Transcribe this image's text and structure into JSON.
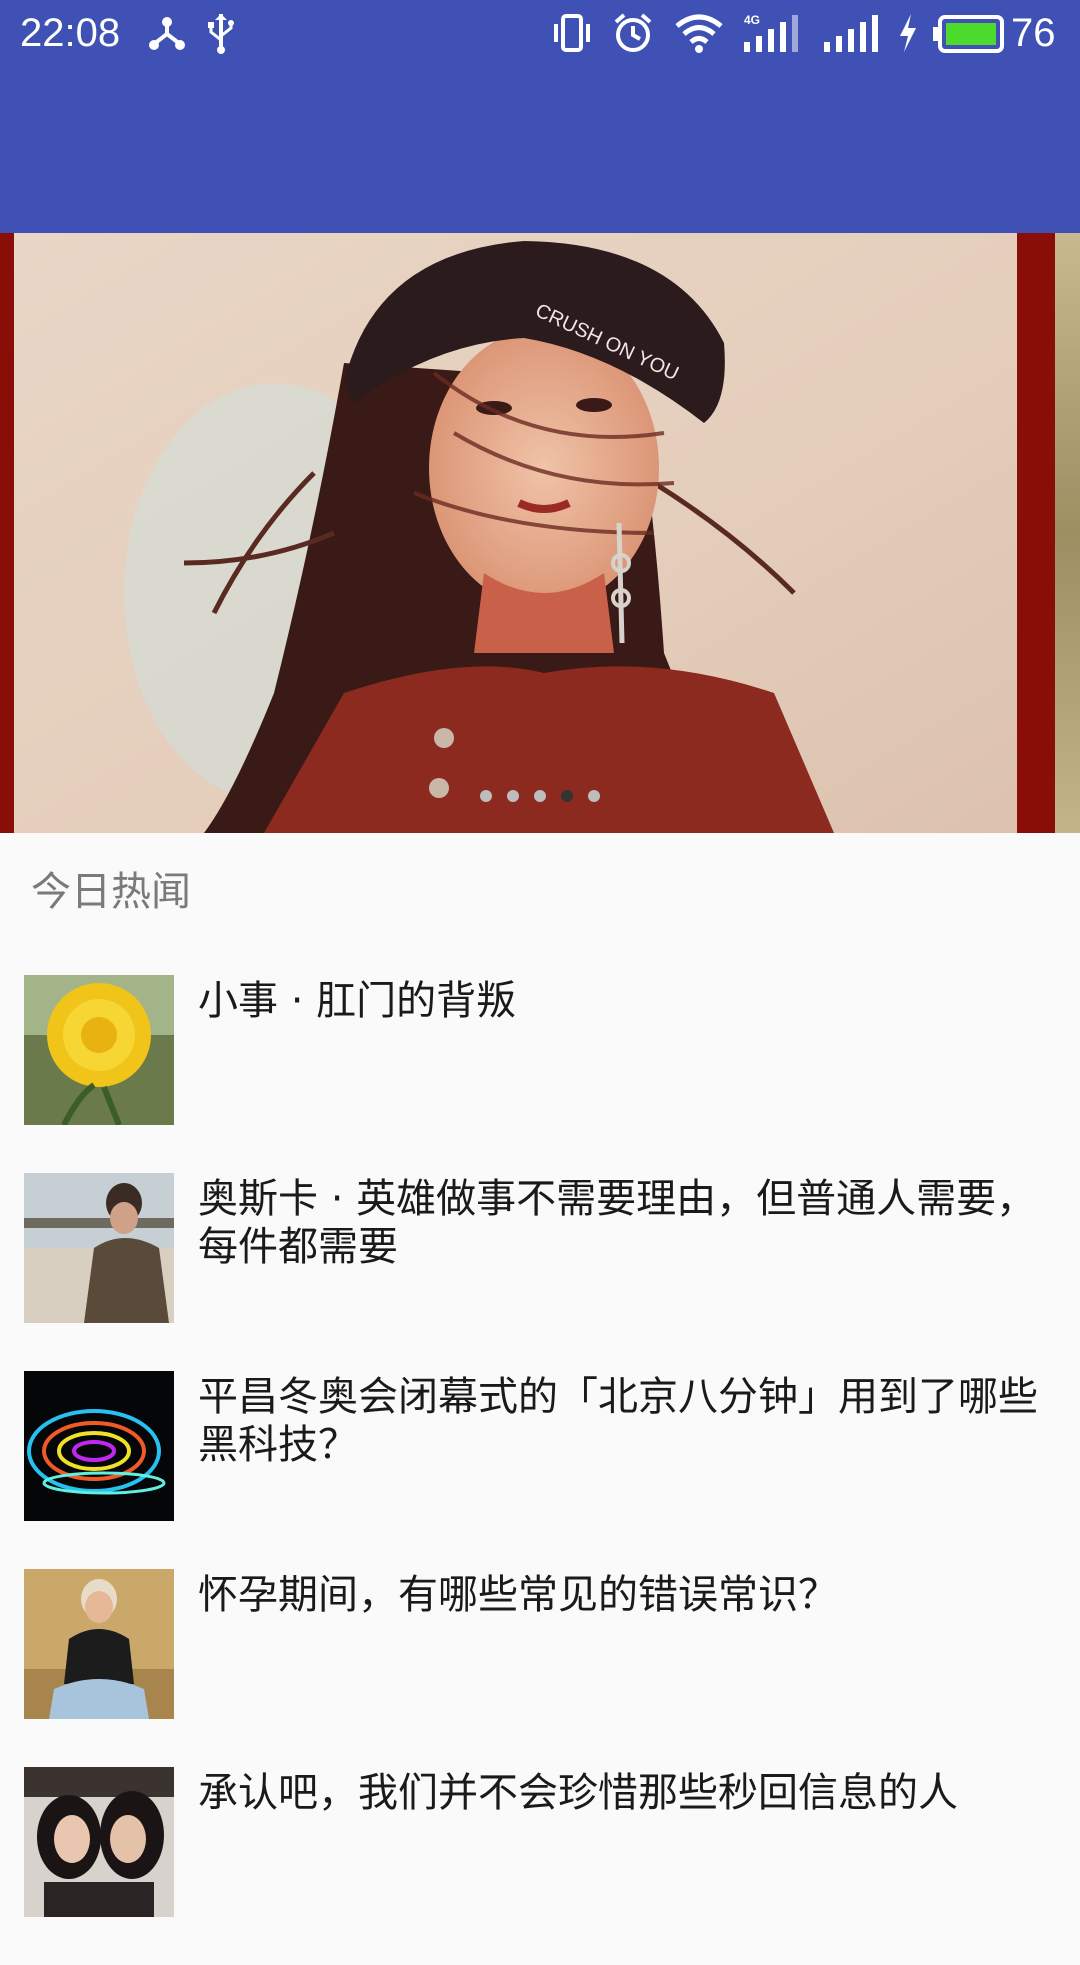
{
  "status_bar": {
    "time": "22:08",
    "battery": "76",
    "icons": [
      "network-share-icon",
      "usb-icon",
      "vibrate-icon",
      "alarm-icon",
      "wifi-icon",
      "4g-signal-icon",
      "signal-icon",
      "charging-icon",
      "battery-icon"
    ],
    "battery_color": "#4cdb2c"
  },
  "app_bar": {
    "color": "#3f51b5"
  },
  "banner": {
    "pager": {
      "count": 5,
      "active_index": 3
    }
  },
  "section": {
    "title": "今日热闻"
  },
  "news": [
    {
      "title": "小事 · 肛门的背叛",
      "thumb": "chrysanthemum-flower"
    },
    {
      "title": "奥斯卡 · 英雄做事不需要理由，但普通人需要，每件都需要",
      "thumb": "soldier-on-beach"
    },
    {
      "title": "平昌冬奥会闭幕式的「北京八分钟」用到了哪些黑科技？",
      "thumb": "light-show"
    },
    {
      "title": "怀孕期间，有哪些常见的错误常识？",
      "thumb": "pregnant-woman"
    },
    {
      "title": "承认吧，我们并不会珍惜那些秒回信息的人",
      "thumb": "two-girls"
    }
  ]
}
